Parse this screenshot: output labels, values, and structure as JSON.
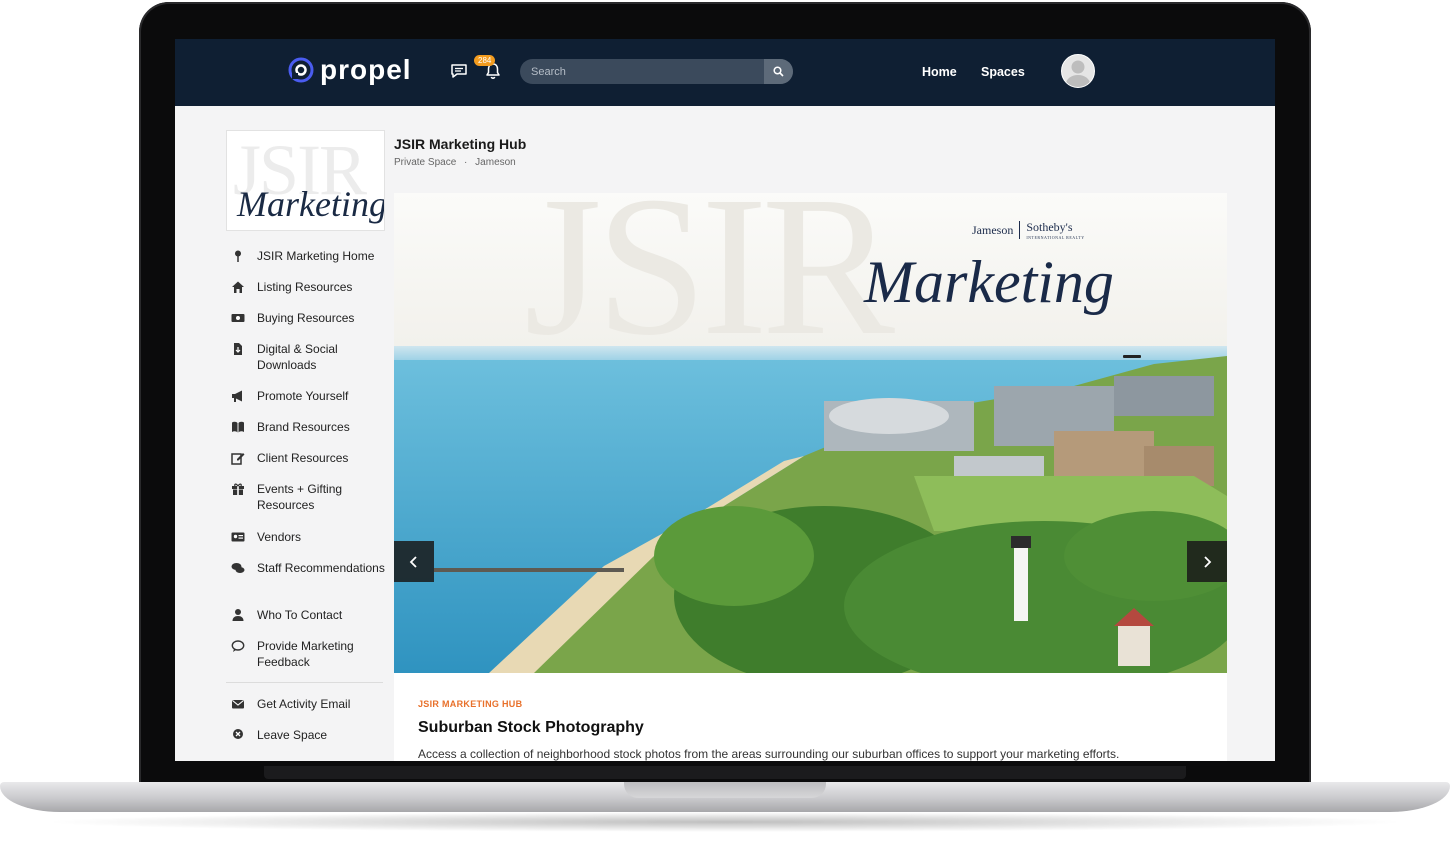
{
  "brand": {
    "name": "propel"
  },
  "topnav": {
    "notification_count": "284",
    "search_placeholder": "Search",
    "links": [
      "Home",
      "Spaces"
    ]
  },
  "sidebar": {
    "tile": {
      "ghost_text": "JSIR",
      "script_text": "Marketing"
    },
    "items": [
      {
        "label": "JSIR Marketing Home",
        "icon": "pin-icon"
      },
      {
        "label": "Listing Resources",
        "icon": "home-icon"
      },
      {
        "label": "Buying Resources",
        "icon": "money-icon"
      },
      {
        "label": "Digital & Social Downloads",
        "icon": "file-download-icon"
      },
      {
        "label": "Promote Yourself",
        "icon": "megaphone-icon"
      },
      {
        "label": "Brand Resources",
        "icon": "book-icon"
      },
      {
        "label": "Client Resources",
        "icon": "edit-icon"
      },
      {
        "label": "Events + Gifting Resources",
        "icon": "gift-icon"
      },
      {
        "label": "Vendors",
        "icon": "id-card-icon"
      },
      {
        "label": "Staff Recommendations",
        "icon": "comments-icon"
      },
      {
        "label": "Who To Contact",
        "icon": "user-icon"
      },
      {
        "label": "Provide Marketing Feedback",
        "icon": "comment-icon"
      }
    ],
    "actions": [
      {
        "label": "Get Activity Email",
        "icon": "envelope-icon"
      },
      {
        "label": "Leave Space",
        "icon": "close-circle-icon"
      }
    ]
  },
  "space": {
    "title": "JSIR Marketing Hub",
    "type": "Private Space",
    "owner": "Jameson",
    "separator": "·"
  },
  "banner": {
    "ghost_text": "JSIR",
    "brand_left": "Jameson",
    "brand_right": "Sotheby's",
    "brand_sub": "INTERNATIONAL REALTY",
    "script_text": "Marketing"
  },
  "card": {
    "kicker": "JSIR MARKETING HUB",
    "title": "Suburban Stock Photography",
    "description": "Access a collection of neighborhood stock photos from the areas surrounding our suburban offices to support your marketing efforts."
  },
  "colors": {
    "nav_bg": "#0f1f33",
    "accent_orange": "#e8702a",
    "badge": "#f39c1f",
    "logo_blue": "#4a5cf0"
  }
}
